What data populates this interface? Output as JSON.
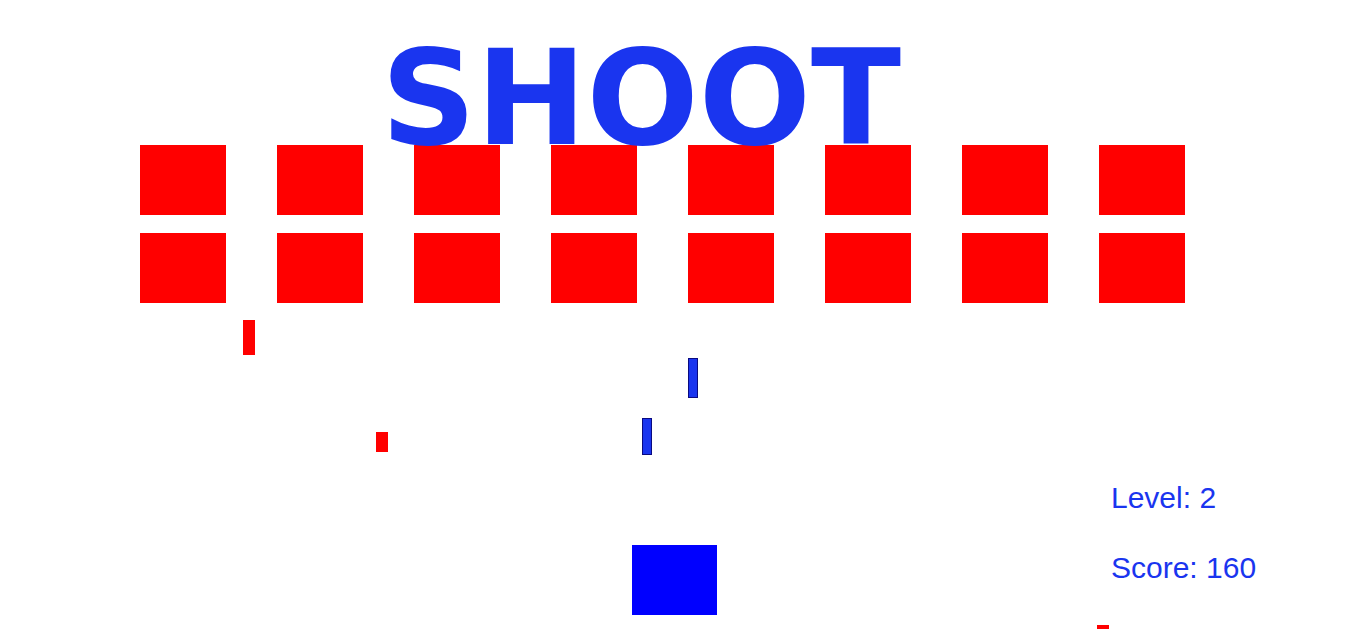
{
  "title": "SHOOT",
  "enemies": {
    "rows": [
      [
        {
          "alive": true
        },
        {
          "alive": true
        },
        {
          "alive": true
        },
        {
          "alive": true
        },
        {
          "alive": true
        },
        {
          "alive": true
        },
        {
          "alive": true
        },
        {
          "alive": true
        }
      ],
      [
        {
          "alive": true
        },
        {
          "alive": true
        },
        {
          "alive": true
        },
        {
          "alive": true
        },
        {
          "alive": true
        },
        {
          "alive": true
        },
        {
          "alive": true
        },
        {
          "alive": true
        }
      ]
    ]
  },
  "bullets": [
    {
      "kind": "enemy"
    },
    {
      "kind": "enemy"
    },
    {
      "kind": "enemy"
    },
    {
      "kind": "player"
    },
    {
      "kind": "player"
    }
  ],
  "player": {
    "alive": true
  },
  "hud": {
    "level": "Level: 2",
    "score": "Score: 160"
  }
}
